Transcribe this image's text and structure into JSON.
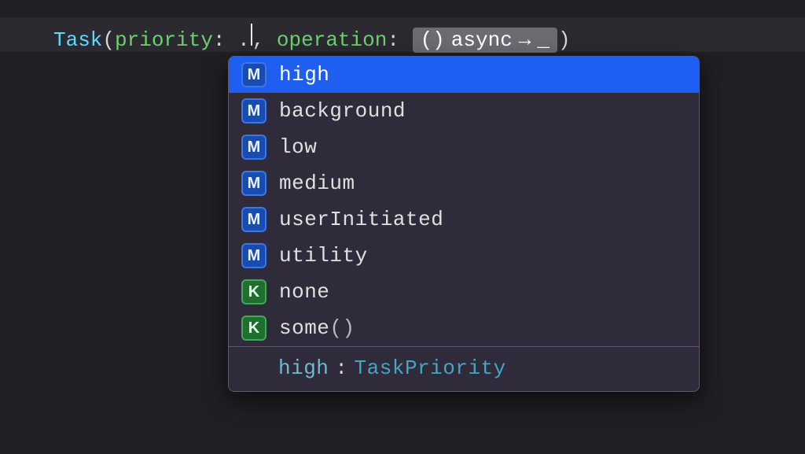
{
  "code_line": {
    "type_token": "Task",
    "open_paren": "(",
    "param_priority": "priority",
    "colon": ":",
    "space": " ",
    "dot": ".",
    "comma_space": ", ",
    "param_operation": "operation",
    "placeholder": {
      "open": "()",
      "keyword": "async",
      "arrow": "→",
      "underscore": "_"
    },
    "close_paren": ")"
  },
  "completions": [
    {
      "kind": "M",
      "label": "high",
      "selected": true
    },
    {
      "kind": "M",
      "label": "background",
      "selected": false
    },
    {
      "kind": "M",
      "label": "low",
      "selected": false
    },
    {
      "kind": "M",
      "label": "medium",
      "selected": false
    },
    {
      "kind": "M",
      "label": "userInitiated",
      "selected": false
    },
    {
      "kind": "M",
      "label": "utility",
      "selected": false
    },
    {
      "kind": "K",
      "label": "none",
      "selected": false
    },
    {
      "kind": "K",
      "label": "some",
      "suffix": "()",
      "selected": false
    }
  ],
  "doc": {
    "name": "high",
    "colon": ":",
    "type": "TaskPriority"
  }
}
